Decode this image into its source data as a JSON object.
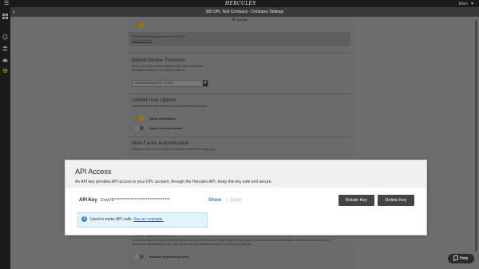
{
  "topbar": {
    "logo": "HERCULES",
    "user": "Ellen",
    "user_caret": "▾",
    "menu_icon": "☰"
  },
  "rail": {
    "icons": [
      "grid-icon",
      "bell-icon",
      "users-icon",
      "cloud-icon",
      "gear-icon"
    ]
  },
  "titlebar": {
    "title": "360 DPL Test Company - Company Settings",
    "back": "‹"
  },
  "panel": {
    "settings_tab": "Settings",
    "gear_glyph": "⚙",
    "atm_note": "Enabling ATM Insights is subject to the DPL",
    "atm_note_link": "Terms of Service",
    "tz": {
      "title": "Default Device Timezone",
      "desc1": "All DL and Viewer devices automatically report timezones.",
      "desc2": "The default setting is for CDMA/DL devices.",
      "value": "America/Toronto (UTC -04:00)",
      "caret": "▾"
    },
    "limited": {
      "title": "Limited User Options",
      "desc": "Grant all limited users permission to activate and unsuspend.",
      "opt1": "Allow Activations",
      "opt2": "Allow Unsuspensions"
    },
    "mfa": {
      "title": "Multi-Factor Authentication",
      "desc": "Require all users to use Multi-Factor Authentication when logging in."
    },
    "portal": {
      "title": "Portal Optimizations",
      "desc1": "You can increase the speed of the portal by excluding archived data. This is helpful for very large or older accounts. Machine data is archived automatically when",
      "desc2": "transferring units between ATMs. You can also archive disabled devices in the device settings tab.",
      "opt": "Exclude Archived Devices"
    }
  },
  "modal": {
    "title": "API Access",
    "desc": "An API key provides API access to your DPL account, through the Hercules API. Keep this key safe and secure.",
    "key_label": "API Key",
    "key_value": "ZrwV5******************************",
    "show": "Show",
    "separator": "|",
    "copy": "Copy",
    "rotate": "Rotate Key",
    "delete": "Delete Key",
    "info_icon": "i",
    "info_text": "Used to make API calls.",
    "info_link": "See an example."
  },
  "help": {
    "icon": "💬",
    "label": "Help"
  }
}
